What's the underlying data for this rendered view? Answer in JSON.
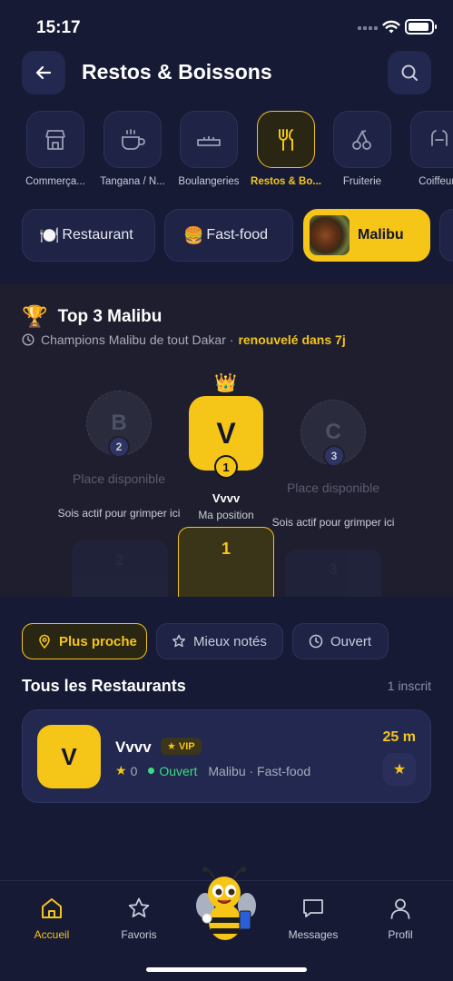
{
  "status_bar": {
    "time": "15:17"
  },
  "header": {
    "title": "Restos & Boissons"
  },
  "categories": [
    {
      "label": "Commerça...",
      "icon": "store-icon"
    },
    {
      "label": "Tangana / N...",
      "icon": "coffee-cup-icon"
    },
    {
      "label": "Boulangeries",
      "icon": "bread-icon"
    },
    {
      "label": "Restos & Bo...",
      "icon": "fork-knife-icon",
      "active": true
    },
    {
      "label": "Fruiterie",
      "icon": "cherries-icon"
    },
    {
      "label": "Coiffeurs",
      "icon": "hair-dryer-icon"
    }
  ],
  "subfilters": {
    "restaurant": {
      "emoji": "🍽️",
      "label": "Restaurant"
    },
    "fastfood": {
      "emoji": "🍔",
      "label": "Fast-food"
    },
    "malibu": {
      "label": "Malibu",
      "active": true
    }
  },
  "top3": {
    "trophy": "🏆",
    "title": "Top 3 Malibu",
    "subtitle": "Champions Malibu de tout Dakar ·",
    "renew": "renouvelé dans 7j",
    "second": {
      "letter": "B",
      "rank": "2",
      "label": "Place disponible",
      "hint": "Sois actif pour grimper ici",
      "podium": "2"
    },
    "first": {
      "crown": "👑",
      "letter": "V",
      "rank": "1",
      "name": "Vvvv",
      "position": "Ma position",
      "podium": "1"
    },
    "third": {
      "letter": "C",
      "rank": "3",
      "label": "Place disponible",
      "hint": "Sois actif pour grimper ici",
      "podium": "3"
    }
  },
  "sort": {
    "nearest": "Plus proche",
    "best_rated": "Mieux notés",
    "open": "Ouvert"
  },
  "list": {
    "title": "Tous les Restaurants",
    "count": "1 inscrit",
    "items": [
      {
        "initial": "V",
        "name": "Vvvv",
        "badge": "VIP",
        "rating": "0",
        "status": "Ouvert",
        "tags": "Malibu · Fast-food",
        "distance": "25 m"
      }
    ]
  },
  "nav": {
    "home": "Accueil",
    "favorites": "Favoris",
    "messages": "Messages",
    "profile": "Profil"
  },
  "colors": {
    "accent": "#f5c518",
    "background": "#161a35",
    "success": "#3ddc84"
  }
}
